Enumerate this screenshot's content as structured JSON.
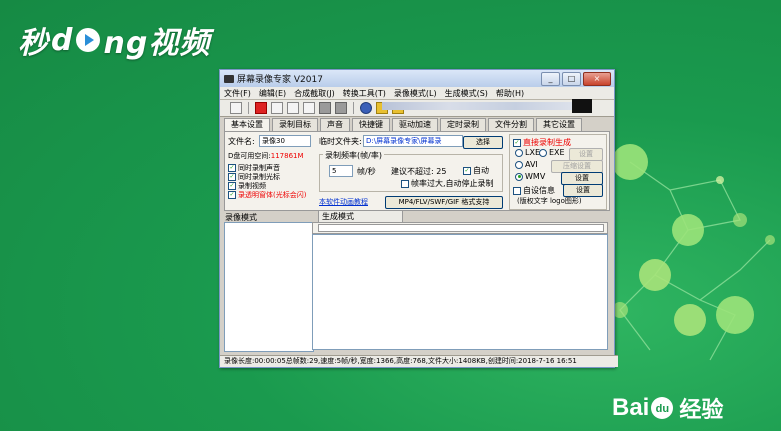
{
  "watermark": {
    "left_a": "秒",
    "left_b": "d",
    "left_c": "ng视频",
    "baidu": "Bai",
    "baidu_paw": "du",
    "baidu_cn": "经验"
  },
  "window": {
    "title": "屏幕录像专家 V2017",
    "controls": {
      "minimize": "_",
      "maximize": "□",
      "close": "×"
    }
  },
  "menu": [
    "文件(F)",
    "编辑(E)",
    "合成截取(J)",
    "转换工具(T)",
    "录像模式(L)",
    "生成模式(S)",
    "帮助(H)"
  ],
  "tabs": [
    "基本设置",
    "录制目标",
    "声音",
    "快捷键",
    "驱动加速",
    "定时录制",
    "文件分割",
    "其它设置"
  ],
  "basic": {
    "filename_label": "文件名:",
    "filename_value": "录像30",
    "temp_folder_label": "临时文件夹:",
    "temp_folder_value": "D:\\屏幕录像专家\\屏幕录",
    "choose_button": "选择",
    "disk_space_label": "D盘可用空间:",
    "disk_space_value": "117861M",
    "checkboxes": [
      {
        "label": "同时录制声音",
        "checked": true
      },
      {
        "label": "同时录制光标",
        "checked": true
      },
      {
        "label": "录制视频",
        "checked": true
      },
      {
        "label": "录透明窗体(光标会闪)",
        "checked": true
      }
    ],
    "tutorial_link": "本软件动画教程",
    "fps_group_label": "录制频率(帧/率)",
    "fps_value": "5",
    "fps_unit": "帧/秒",
    "fps_suggest_label": "建议不超过:",
    "fps_suggest_value": "25",
    "auto_label": "自动",
    "auto_stop_label": "帧率过大,自动停止录制",
    "format_button": "MP4/FLV/SWF/GIF  格式支持",
    "direct_gen_label": "直接录制生成",
    "formats": [
      {
        "label": "LXE",
        "selected": false
      },
      {
        "label": "EXE",
        "selected": false
      },
      {
        "label": "AVI",
        "selected": false
      },
      {
        "label": "WMV",
        "selected": true
      }
    ],
    "settings_button": "设置",
    "compress_button": "压缩设置",
    "auto_info_label": "自设信息",
    "copyright_label": "(版权文字 logo图形)"
  },
  "left_panel_label": "录像模式",
  "right_panel_label": "生成模式",
  "statusbar": "录像长度:00:00:05总帧数:29,速度:5帧/秒,宽度:1366,高度:768,文件大小:1408KB,创建时间:2018-7-16 16:51"
}
